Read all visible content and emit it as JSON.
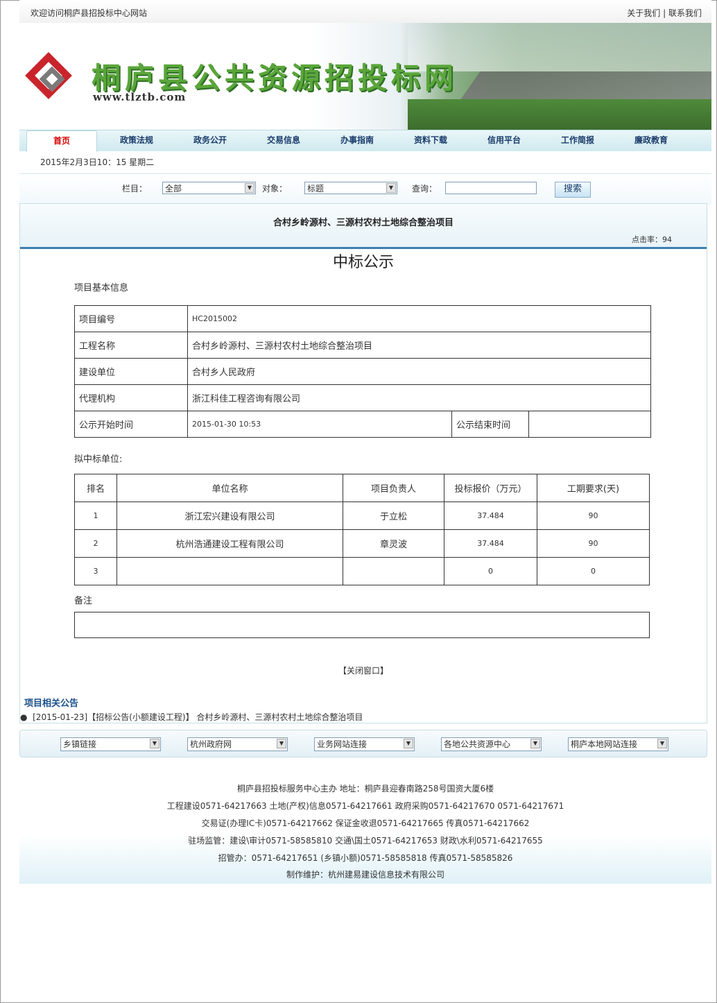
{
  "topbar": {
    "welcome": "欢迎访问桐庐县招投标中心网站",
    "about": "关于我们",
    "sep": "|",
    "contact": "联系我们"
  },
  "banner": {
    "title": "桐庐县公共资源招投标网",
    "url": "www.tlztb.com"
  },
  "nav": [
    "首页",
    "政策法规",
    "政务公开",
    "交易信息",
    "办事指南",
    "资料下载",
    "信用平台",
    "工作简报",
    "廉政教育"
  ],
  "date": "2015年2月3日10：15 星期二",
  "search": {
    "column_label": "栏目：",
    "column_value": "全部",
    "object_label": "对象：",
    "object_value": "标题",
    "query_label": "查询：",
    "button": "搜索"
  },
  "article": {
    "title": "合村乡岭源村、三源村农村土地综合整治项目",
    "hits": "点击率：94",
    "heading": "中标公示"
  },
  "basic": {
    "section": "项目基本信息",
    "rows": [
      {
        "k": "项目编号",
        "v": "HC2015002"
      },
      {
        "k": "工程名称",
        "v": "合村乡岭源村、三源村农村土地综合整治项目"
      },
      {
        "k": "建设单位",
        "v": "合村乡人民政府"
      },
      {
        "k": "代理机构",
        "v": "浙江科佳工程咨询有限公司"
      }
    ],
    "start_k": "公示开始时间",
    "start_v": "2015-01-30 10:53",
    "end_k": "公示结束时间",
    "end_v": ""
  },
  "winners": {
    "section": "拟中标单位:",
    "headers": [
      "排名",
      "单位名称",
      "项目负责人",
      "投标报价（万元）",
      "工期要求(天)"
    ],
    "rows": [
      [
        "1",
        "浙江宏兴建设有限公司",
        "于立松",
        "37.484",
        "90"
      ],
      [
        "2",
        "杭州浩通建设工程有限公司",
        "章灵波",
        "37.484",
        "90"
      ],
      [
        "3",
        "",
        "",
        "0",
        "0"
      ]
    ]
  },
  "remark": "备注",
  "close": "【关闭窗口】",
  "related": {
    "title": "项目相关公告",
    "item": "[2015-01-23]【招标公告(小额建设工程)】 合村乡岭源村、三源村农村土地综合整治项目"
  },
  "links": [
    "乡镇链接",
    "杭州政府网",
    "业务网站连接",
    "各地公共资源中心",
    "桐庐本地网站连接"
  ],
  "footer": [
    "桐庐县招投标服务中心主办  地址：桐庐县迎春南路258号国资大厦6楼",
    "工程建设0571-64217663  土地(产权)信息0571-64217661  政府采购0571-64217670 0571-64217671",
    "交易证(办理IC卡)0571-64217662  保证金收退0571-64217665  传真0571-64217662",
    "驻场监管：建设\\审计0571-58585810 交通\\国土0571-64217653  财政\\水利0571-64217655",
    "招管办：0571-64217651 (乡镇小额)0571-58585818 传真0571-58585826",
    "制作维护：杭州建易建设信息技术有限公司"
  ],
  "colors": {
    "nav_active": "#d40000",
    "accent_blue": "#3d7fb2",
    "title_green": "#5aa63a"
  }
}
